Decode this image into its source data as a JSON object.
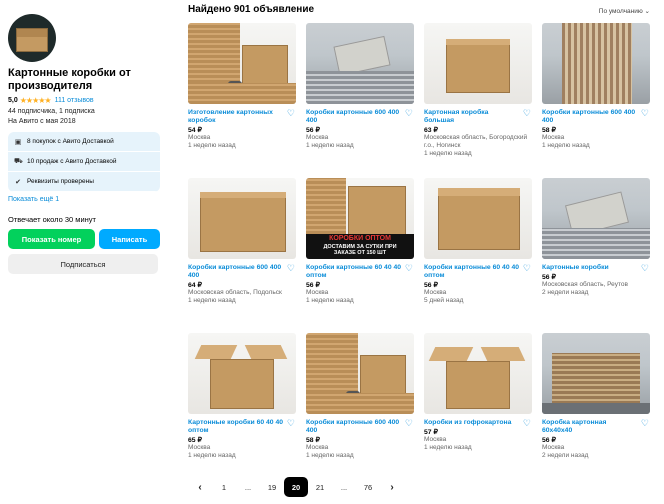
{
  "seller": {
    "name": "Картонные коробки от производителя",
    "rating": "5,0",
    "stars": "★★★★★",
    "reviews": "111 отзывов",
    "subscribers": "44 подписчика, 1 подписка",
    "since": "На Авито с мая 2018",
    "badges": [
      {
        "icon": "cart-icon",
        "glyph": "🛒",
        "text": "8 покупок с Авито Доставкой"
      },
      {
        "icon": "truck-icon",
        "glyph": "⛟",
        "text": "10 продаж с Авито Доставкой"
      },
      {
        "icon": "check-circle-icon",
        "glyph": "✔",
        "text": "Реквизиты проверены"
      }
    ],
    "show_more": "Показать ещё 1",
    "answers": "Отвечает около 30 минут",
    "btn_phone": "Показать номер",
    "btn_write": "Написать",
    "btn_subscribe": "Подписаться"
  },
  "header": {
    "found": "Найдено 901 объявление",
    "sort": "По умолчанию ⌄"
  },
  "cards": [
    {
      "title": "Изготовление картонных коробок",
      "price": "54 ₽",
      "loc": "Москва",
      "date": "1 неделю назад"
    },
    {
      "title": "Коробки картонные 600 400 400",
      "price": "56 ₽",
      "loc": "Москва",
      "date": "1 неделю назад"
    },
    {
      "title": "Картонная коробка большая",
      "price": "63 ₽",
      "loc": "Московская область, Богородский г.о., Ногинск",
      "date": "1 неделю назад"
    },
    {
      "title": "Коробки картонные 600 400 400",
      "price": "58 ₽",
      "loc": "Москва",
      "date": "1 неделю назад"
    },
    {
      "title": "Коробки картонные 600 400 400",
      "price": "64 ₽",
      "loc": "Московская область, Подольск",
      "date": "1 неделю назад"
    },
    {
      "title": "Коробки картонные 60 40 40 оптом",
      "price": "56 ₽",
      "loc": "Москва",
      "date": "1 неделю назад"
    },
    {
      "title": "Коробки картонные 60 40 40 оптом",
      "price": "56 ₽",
      "loc": "Москва",
      "date": "5 дней назад"
    },
    {
      "title": "Картонные коробки",
      "price": "56 ₽",
      "loc": "Московская область, Реутов",
      "date": "2 недели назад"
    },
    {
      "title": "Картонные коробки 60 40 40 оптом",
      "price": "65 ₽",
      "loc": "Москва",
      "date": "1 неделю назад"
    },
    {
      "title": "Коробки картонные 600 400 400",
      "price": "58 ₽",
      "loc": "Москва",
      "date": "1 неделю назад"
    },
    {
      "title": "Коробки из гофрокартона",
      "price": "57 ₽",
      "loc": "Москва",
      "date": "1 неделю назад"
    },
    {
      "title": "Коробка картонная 60х40х40",
      "price": "56 ₽",
      "loc": "Москва",
      "date": "2 недели назад"
    }
  ],
  "banner": {
    "line1": "КОРОБКИ ОПТОМ",
    "line2": "ДОСТАВИМ ЗА СУТКИ ПРИ",
    "line3": "ЗАКАЗЕ ОТ 150 ШТ"
  },
  "pagination": {
    "prev": "‹",
    "pages": [
      "1",
      "...",
      "19",
      "20",
      "21",
      "...",
      "76"
    ],
    "active": "20",
    "next": "›"
  }
}
